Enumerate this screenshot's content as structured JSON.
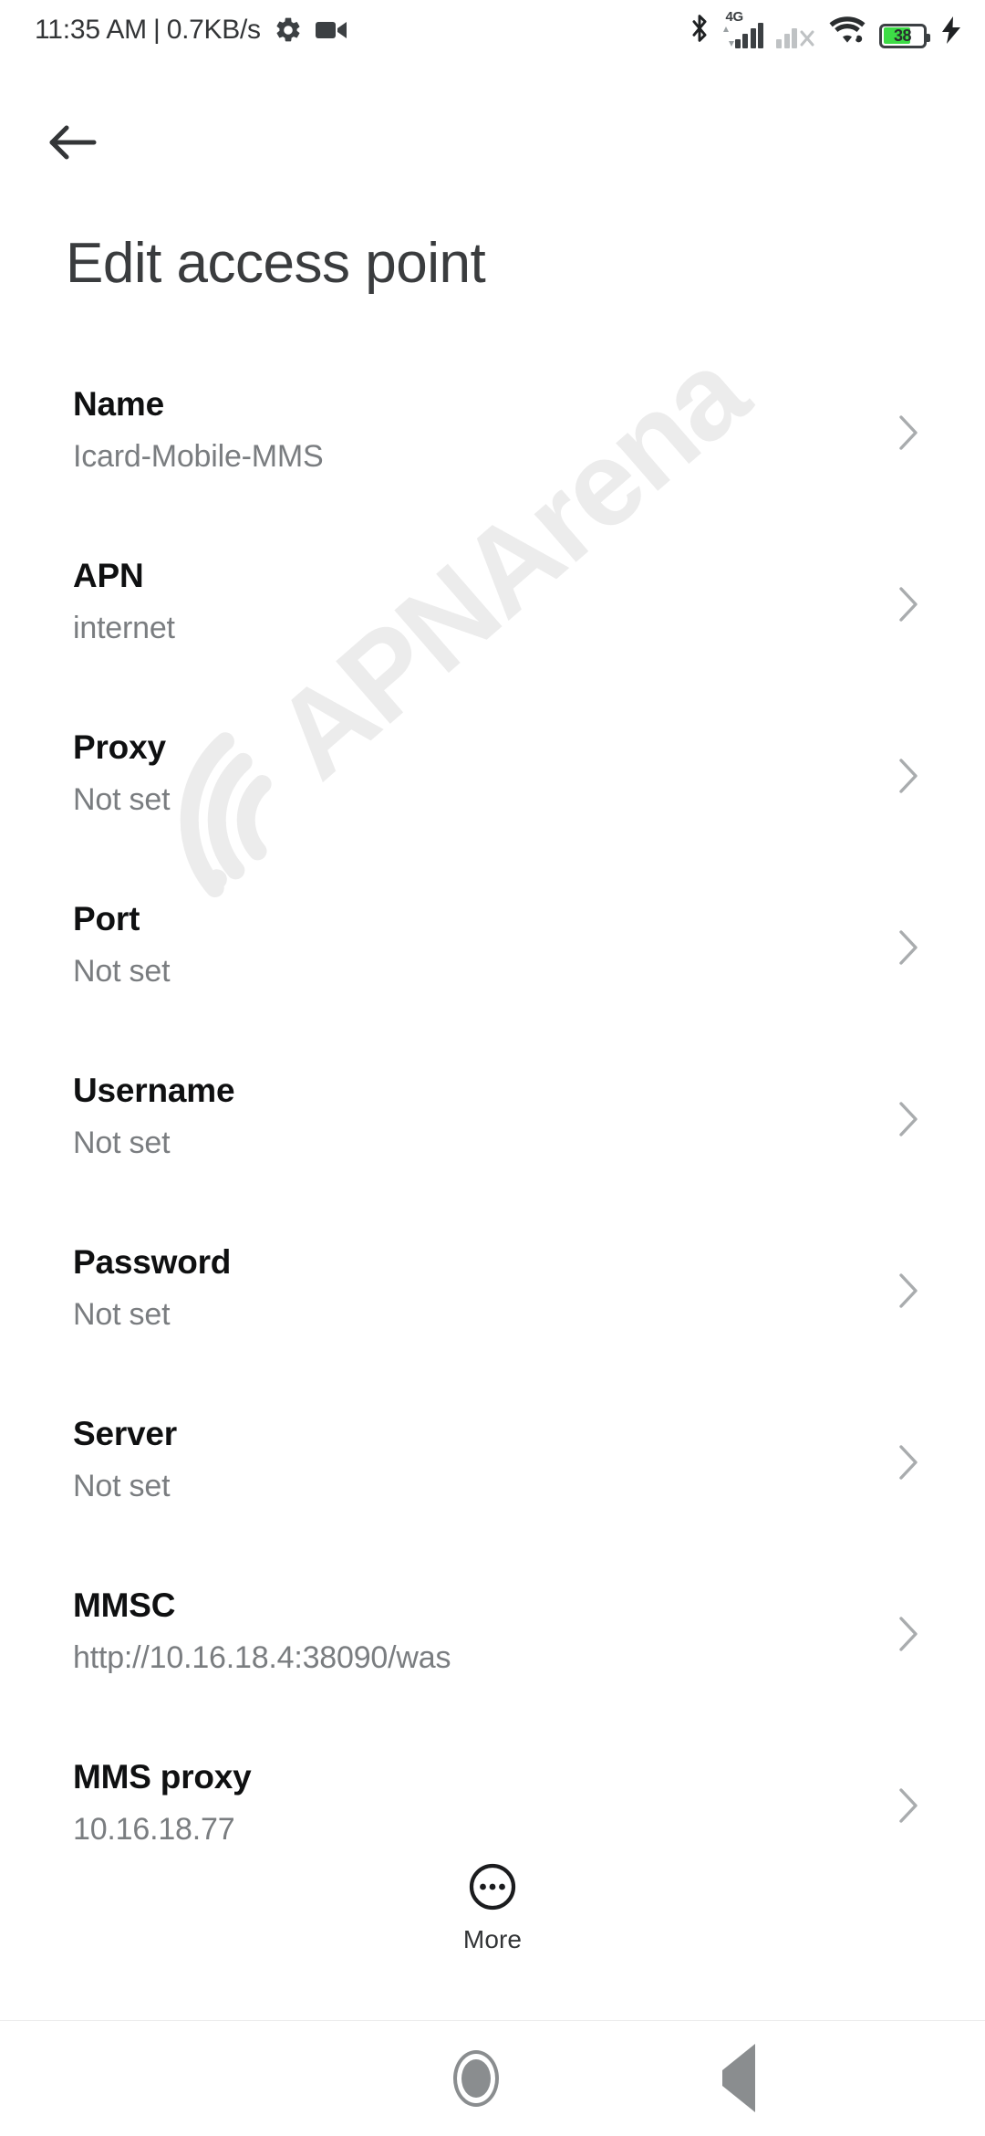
{
  "status_bar": {
    "clock": "11:35 AM",
    "separator": "|",
    "data_rate": "0.7KB/s",
    "icons_left": [
      "gear-icon",
      "video-camera-icon"
    ],
    "icons_right": [
      "bluetooth-icon",
      "signal-4g-icon",
      "signal-no-sim-icon",
      "wifi-icon",
      "battery-icon",
      "charging-bolt-icon"
    ],
    "network_type": "4G",
    "battery_percent": "38",
    "battery_color": "#3ddc46",
    "charging": true
  },
  "header": {
    "back_icon": "arrow-left-icon",
    "title": "Edit access point"
  },
  "watermark": {
    "text": "APNArena",
    "color": "#ececec",
    "icon": "wifi-signal-icon"
  },
  "list": {
    "chevron_icon": "chevron-right-icon",
    "rows": [
      {
        "title": "Name",
        "value": "Icard-Mobile-MMS"
      },
      {
        "title": "APN",
        "value": "internet"
      },
      {
        "title": "Proxy",
        "value": "Not set"
      },
      {
        "title": "Port",
        "value": "Not set"
      },
      {
        "title": "Username",
        "value": "Not set"
      },
      {
        "title": "Password",
        "value": "Not set"
      },
      {
        "title": "Server",
        "value": "Not set"
      },
      {
        "title": "MMSC",
        "value": "http://10.16.18.4:38090/was"
      },
      {
        "title": "MMS proxy",
        "value": "10.16.18.77"
      }
    ]
  },
  "more_button": {
    "label": "More",
    "icon": "circle-ellipsis-icon"
  },
  "nav_bar": {
    "recents_label": "recents-square-icon",
    "home_label": "home-circle-icon",
    "back_label": "back-triangle-icon"
  }
}
